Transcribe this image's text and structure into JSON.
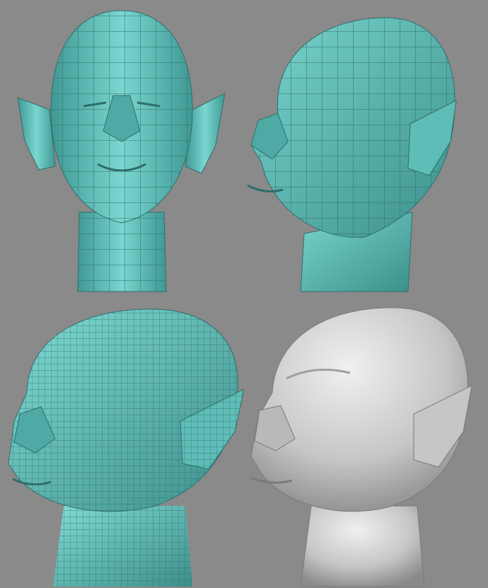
{
  "background": "#8a8a8a",
  "panels": [
    {
      "id": "front-lowpoly",
      "view": "front",
      "shading": "lowpoly-mesh",
      "color": "#5fbdb8"
    },
    {
      "id": "threequarter-lowpoly",
      "view": "three-quarter",
      "shading": "lowpoly-mesh",
      "color": "#5fbdb8"
    },
    {
      "id": "threequarter-dense",
      "view": "three-quarter",
      "shading": "dense-mesh",
      "color": "#5fbdb8"
    },
    {
      "id": "threequarter-sculpt",
      "view": "three-quarter",
      "shading": "smooth-sculpt",
      "color": "#c4c4c4"
    }
  ]
}
